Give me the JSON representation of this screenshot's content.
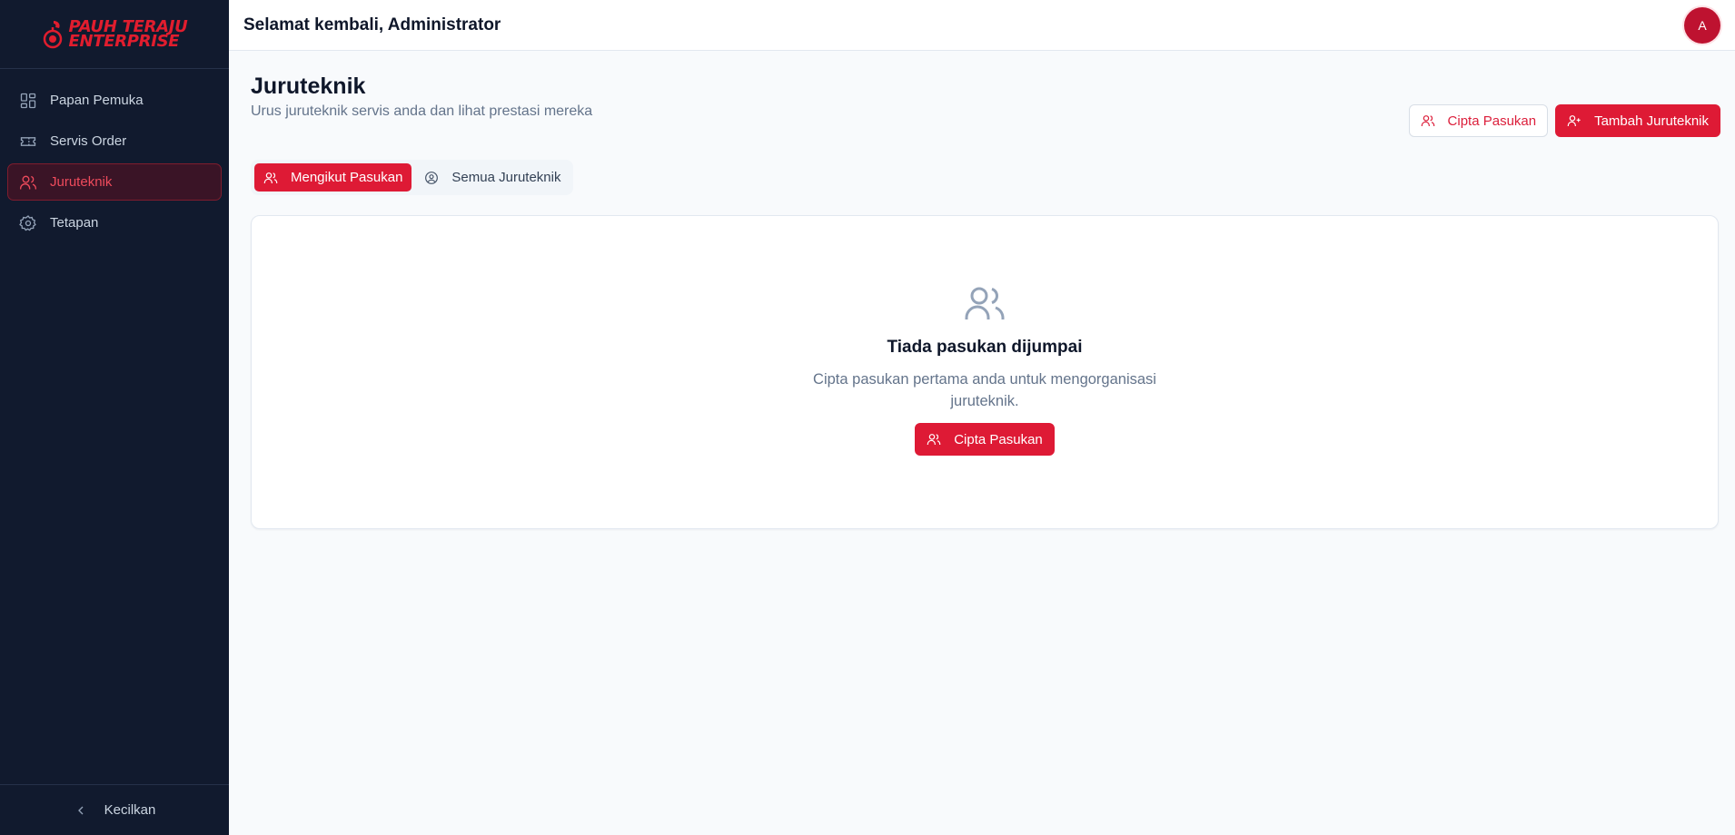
{
  "brand": {
    "line1": "PAUH TERAJU",
    "line2": "ENTERPRISE",
    "color": "#e11d2e"
  },
  "sidebar": {
    "items": [
      {
        "label": "Papan Pemuka",
        "icon": "dashboard-grid-icon",
        "active": false
      },
      {
        "label": "Servis Order",
        "icon": "ticket-icon",
        "active": false
      },
      {
        "label": "Juruteknik",
        "icon": "users-icon",
        "active": true
      },
      {
        "label": "Tetapan",
        "icon": "gear-icon",
        "active": false
      }
    ],
    "collapse_label": "Kecilkan"
  },
  "header": {
    "greeting": "Selamat kembali, Administrator",
    "avatar_initial": "A"
  },
  "page": {
    "title": "Juruteknik",
    "subtitle": "Urus juruteknik servis anda dan lihat prestasi mereka",
    "actions": {
      "create_team": "Cipta Pasukan",
      "add_technician": "Tambah Juruteknik"
    }
  },
  "tabs": [
    {
      "label": "Mengikut Pasukan",
      "icon": "users-icon",
      "active": true
    },
    {
      "label": "Semua Juruteknik",
      "icon": "user-circle-icon",
      "active": false
    }
  ],
  "empty_state": {
    "icon": "users-icon",
    "title": "Tiada pasukan dijumpai",
    "description": "Cipta pasukan pertama anda untuk mengorganisasi juruteknik.",
    "button": "Cipta Pasukan"
  },
  "colors": {
    "accent": "#de1a35",
    "sidebar_bg": "#111a2e",
    "page_bg": "#f8fafc"
  }
}
